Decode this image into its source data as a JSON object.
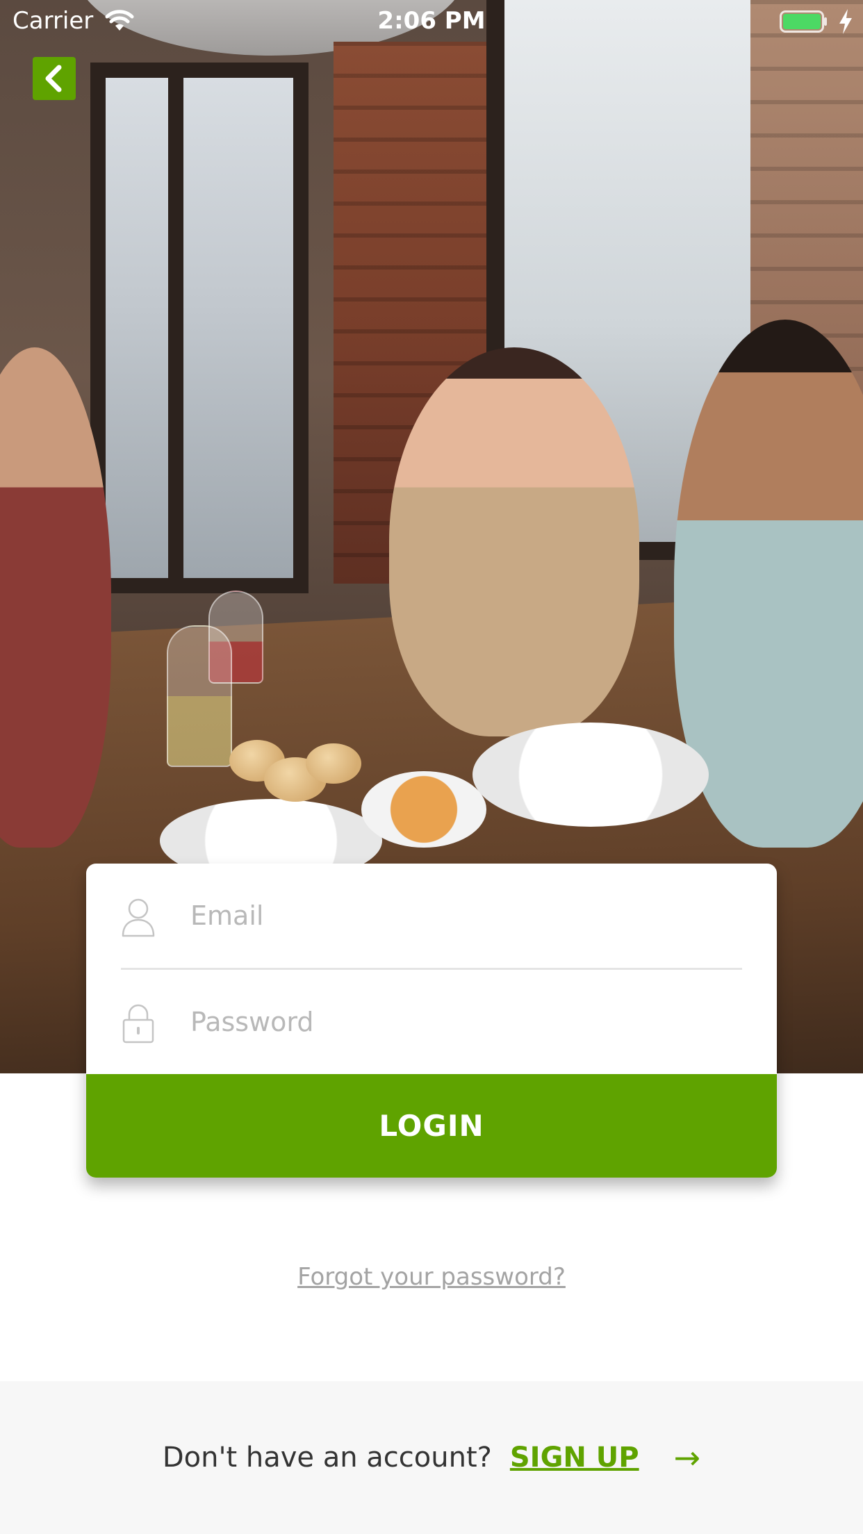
{
  "status_bar": {
    "carrier": "Carrier",
    "time": "2:06 PM",
    "wifi_icon": "wifi-icon",
    "battery_icon": "battery-icon",
    "charging_icon": "charging-bolt-icon"
  },
  "nav": {
    "back_icon": "chevron-left-icon"
  },
  "login_form": {
    "email": {
      "placeholder": "Email",
      "value": "",
      "icon": "user-icon"
    },
    "password": {
      "placeholder": "Password",
      "value": "",
      "icon": "lock-icon"
    },
    "login_label": "LOGIN"
  },
  "forgot_password": "Forgot your password?",
  "signup": {
    "prompt": "Don't have an account?",
    "link_label": "SIGN UP",
    "arrow": "→"
  },
  "colors": {
    "accent": "#5fa300",
    "footer_background": "#f7f7f7",
    "placeholder": "#b8b8b8"
  }
}
